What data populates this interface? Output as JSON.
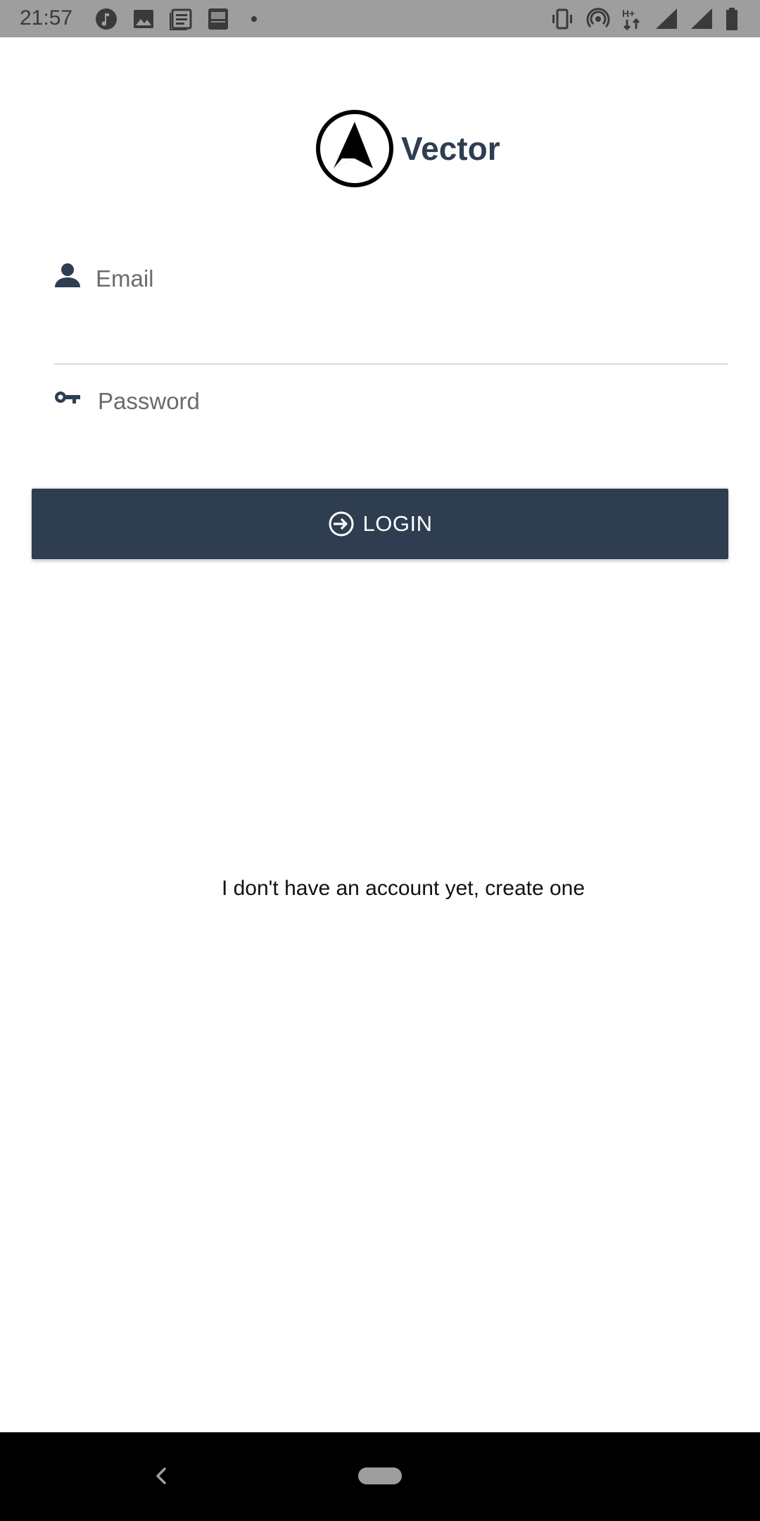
{
  "status_bar": {
    "time": "21:57",
    "left_icons": [
      "music-note-icon",
      "image-icon",
      "news-icon",
      "bible-app-icon",
      "notification-dot-icon"
    ],
    "right_icons": [
      "vibrate-icon",
      "hotspot-icon",
      "data-hplus-icon",
      "signal-icon",
      "signal-icon-2",
      "battery-icon"
    ]
  },
  "app": {
    "name": "Vector",
    "brand_color": "#2e3e50"
  },
  "form": {
    "email": {
      "placeholder": "Email",
      "value": "",
      "icon": "person-icon"
    },
    "password": {
      "placeholder": "Password",
      "value": "",
      "icon": "key-icon"
    },
    "login_button": {
      "label": "LOGIN",
      "icon": "login-arrow-icon"
    }
  },
  "create_account_link": "I don't have an account yet, create one",
  "nav_bar": {
    "icons": [
      "back-icon",
      "home-pill-icon"
    ]
  }
}
